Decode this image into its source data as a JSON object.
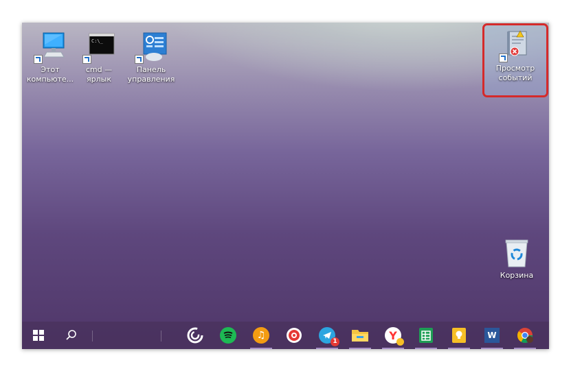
{
  "desktop": {
    "icons": [
      {
        "id": "this-pc",
        "label_line1": "Этот",
        "label_line2": "компьюте...",
        "icon": "monitor-icon"
      },
      {
        "id": "cmd",
        "label_line1": "cmd —",
        "label_line2": "ярлык",
        "icon": "cmd-icon",
        "cmd_text": "C:\\_"
      },
      {
        "id": "control-panel",
        "label_line1": "Панель",
        "label_line2": "управления",
        "icon": "control-panel-icon"
      },
      {
        "id": "event-viewer",
        "label_line1": "Просмотр",
        "label_line2": "событий",
        "icon": "event-viewer-icon",
        "highlighted": true
      },
      {
        "id": "recycle-bin",
        "label_line1": "Корзина",
        "label_line2": "",
        "icon": "recycle-bin-icon"
      }
    ],
    "highlight_color": "#d52a2a"
  },
  "taskbar": {
    "start": "windows-start-icon",
    "search": "search-icon",
    "apps": [
      {
        "name": "cortana-app",
        "icon": "cortana-icon",
        "color": "#ffffff"
      },
      {
        "name": "spotify-app",
        "icon": "spotify-icon",
        "color": "#1db954"
      },
      {
        "name": "music-app",
        "icon": "music-icon",
        "color": "#f39c12"
      },
      {
        "name": "red-app",
        "icon": "red-target-icon",
        "color": "#e53935"
      },
      {
        "name": "telegram-app",
        "icon": "telegram-icon",
        "color": "#2ca5e0",
        "badge": "1"
      },
      {
        "name": "explorer-app",
        "icon": "folder-icon",
        "color": "#f4c542"
      },
      {
        "name": "yandex-browser-app",
        "icon": "yandex-browser-icon",
        "color": "#ff3333"
      },
      {
        "name": "sheets-app",
        "icon": "sheets-icon",
        "color": "#1e9e55"
      },
      {
        "name": "keep-app",
        "icon": "lightbulb-icon",
        "color": "#f6bf26"
      },
      {
        "name": "word-app",
        "icon": "word-icon",
        "color": "#2b579a",
        "text": "W"
      },
      {
        "name": "chrome-app",
        "icon": "chrome-icon",
        "color": "#db4437"
      }
    ]
  }
}
